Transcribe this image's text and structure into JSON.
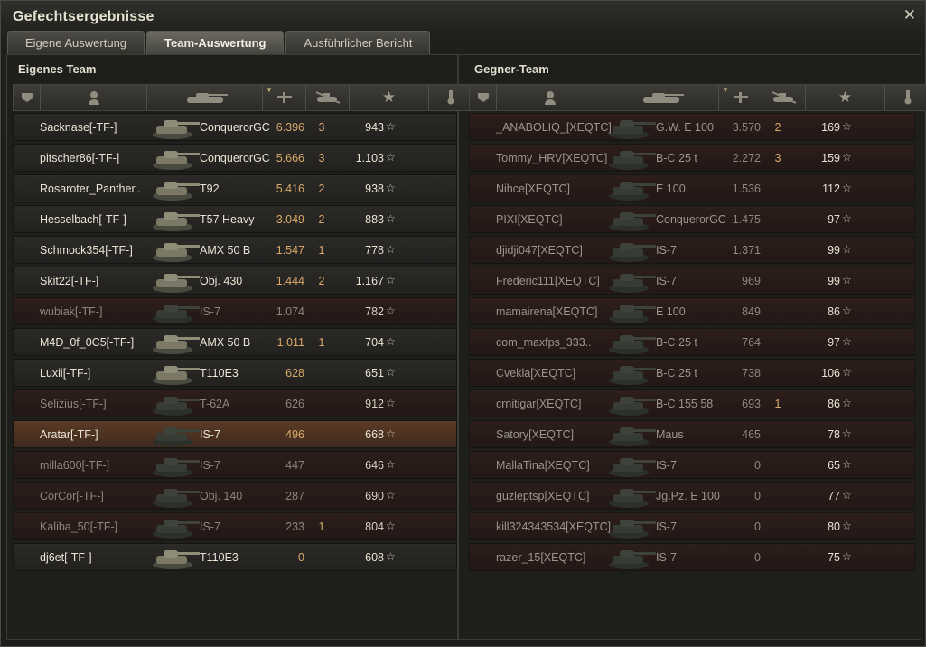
{
  "window": {
    "title": "Gefechtsergebnisse",
    "close_icon": "close-icon"
  },
  "tabs": [
    {
      "label": "Eigene Auswertung",
      "active": false
    },
    {
      "label": "Team-Auswertung",
      "active": true
    },
    {
      "label": "Ausführlicher Bericht",
      "active": false
    }
  ],
  "own_team": {
    "title": "Eigenes Team",
    "players": [
      {
        "name": "Sacknase[-TF-]",
        "tank": "ConquerorGC",
        "damage": "6.396",
        "kills": "3",
        "xp": "943",
        "state": "alive"
      },
      {
        "name": "pitscher86[-TF-]",
        "tank": "ConquerorGC",
        "damage": "5.666",
        "kills": "3",
        "xp": "1.103",
        "state": "alive"
      },
      {
        "name": "Rosaroter_Panther..",
        "tank": "T92",
        "damage": "5.416",
        "kills": "2",
        "xp": "938",
        "state": "alive"
      },
      {
        "name": "Hesselbach[-TF-]",
        "tank": "T57 Heavy",
        "damage": "3.049",
        "kills": "2",
        "xp": "883",
        "state": "alive"
      },
      {
        "name": "Schmock354[-TF-]",
        "tank": "AMX 50 B",
        "damage": "1.547",
        "kills": "1",
        "xp": "778",
        "state": "alive"
      },
      {
        "name": "Skit22[-TF-]",
        "tank": "Obj. 430",
        "damage": "1.444",
        "kills": "2",
        "xp": "1.167",
        "state": "alive"
      },
      {
        "name": "wubiak[-TF-]",
        "tank": "IS-7",
        "damage": "1.074",
        "kills": "",
        "xp": "782",
        "state": "dead"
      },
      {
        "name": "M4D_0f_0C5[-TF-]",
        "tank": "AMX 50 B",
        "damage": "1.011",
        "kills": "1",
        "xp": "704",
        "state": "alive"
      },
      {
        "name": "Luxii[-TF-]",
        "tank": "T110E3",
        "damage": "628",
        "kills": "",
        "xp": "651",
        "state": "alive"
      },
      {
        "name": "Selizius[-TF-]",
        "tank": "T-62A",
        "damage": "626",
        "kills": "",
        "xp": "912",
        "state": "dead"
      },
      {
        "name": "Aratar[-TF-]",
        "tank": "IS-7",
        "damage": "496",
        "kills": "",
        "xp": "668",
        "state": "highlight"
      },
      {
        "name": "milla600[-TF-]",
        "tank": "IS-7",
        "damage": "447",
        "kills": "",
        "xp": "646",
        "state": "dead"
      },
      {
        "name": "CorCor[-TF-]",
        "tank": "Obj. 140",
        "damage": "287",
        "kills": "",
        "xp": "690",
        "state": "dead"
      },
      {
        "name": "Kaliba_50[-TF-]",
        "tank": "IS-7",
        "damage": "233",
        "kills": "1",
        "xp": "804",
        "state": "dead"
      },
      {
        "name": "dj6et[-TF-]",
        "tank": "T110E3",
        "damage": "0",
        "kills": "",
        "xp": "608",
        "state": "alive"
      }
    ]
  },
  "enemy_team": {
    "title": "Gegner-Team",
    "players": [
      {
        "name": "_ANABOLIQ_[XEQTC]",
        "tank": "G.W. E 100",
        "damage": "3.570",
        "kills": "2",
        "xp": "169"
      },
      {
        "name": "Tommy_HRV[XEQTC]",
        "tank": "B-C 25 t",
        "damage": "2.272",
        "kills": "3",
        "xp": "159"
      },
      {
        "name": "Nihce[XEQTC]",
        "tank": "E 100",
        "damage": "1.536",
        "kills": "",
        "xp": "112"
      },
      {
        "name": "PIXI[XEQTC]",
        "tank": "ConquerorGC",
        "damage": "1.475",
        "kills": "",
        "xp": "97"
      },
      {
        "name": "djidji047[XEQTC]",
        "tank": "IS-7",
        "damage": "1.371",
        "kills": "",
        "xp": "99"
      },
      {
        "name": "Frederic111[XEQTC]",
        "tank": "IS-7",
        "damage": "969",
        "kills": "",
        "xp": "99"
      },
      {
        "name": "mamairena[XEQTC]",
        "tank": "E 100",
        "damage": "849",
        "kills": "",
        "xp": "86"
      },
      {
        "name": "com_maxfps_333..",
        "tank": "B-C 25 t",
        "damage": "764",
        "kills": "",
        "xp": "97"
      },
      {
        "name": "Cvekla[XEQTC]",
        "tank": "B-C 25 t",
        "damage": "738",
        "kills": "",
        "xp": "106"
      },
      {
        "name": "crnitigar[XEQTC]",
        "tank": "B-C 155 58",
        "damage": "693",
        "kills": "1",
        "xp": "86"
      },
      {
        "name": "Satory[XEQTC]",
        "tank": "Maus",
        "damage": "465",
        "kills": "",
        "xp": "78"
      },
      {
        "name": "MallaTina[XEQTC]",
        "tank": "IS-7",
        "damage": "0",
        "kills": "",
        "xp": "65"
      },
      {
        "name": "guzleptsp[XEQTC]",
        "tank": "Jg.Pz. E 100",
        "damage": "0",
        "kills": "",
        "xp": "77"
      },
      {
        "name": "kill324343534[XEQTC]",
        "tank": "IS-7",
        "damage": "0",
        "kills": "",
        "xp": "80"
      },
      {
        "name": "razer_15[XEQTC]",
        "tank": "IS-7",
        "damage": "0",
        "kills": "",
        "xp": "75"
      }
    ]
  },
  "columns": [
    {
      "icon": "medal-badge-icon"
    },
    {
      "icon": "player-icon"
    },
    {
      "icon": "tank-icon"
    },
    {
      "icon": "damage-icon"
    },
    {
      "icon": "kills-icon"
    },
    {
      "icon": "experience-star-icon"
    },
    {
      "icon": "award-icon"
    }
  ],
  "colors": {
    "damage": "#d7a968",
    "dead_row": "#2d1e1b",
    "highlight_row": "#5b3a26"
  }
}
